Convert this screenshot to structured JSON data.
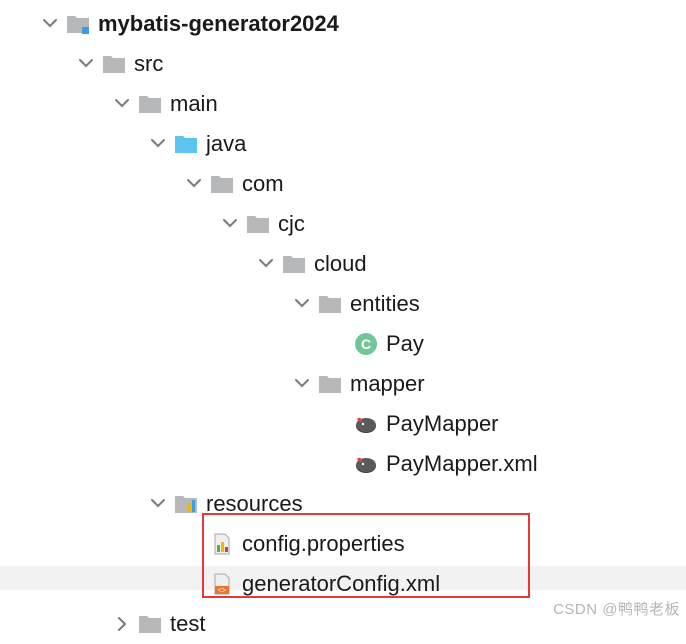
{
  "tree": {
    "root": {
      "label": "mybatis-generator2024"
    },
    "src": {
      "label": "src"
    },
    "main": {
      "label": "main"
    },
    "java": {
      "label": "java"
    },
    "com": {
      "label": "com"
    },
    "cjc": {
      "label": "cjc"
    },
    "cloud": {
      "label": "cloud"
    },
    "entities": {
      "label": "entities"
    },
    "pay": {
      "label": "Pay"
    },
    "mapper": {
      "label": "mapper"
    },
    "paymapper": {
      "label": "PayMapper"
    },
    "paymapperxml": {
      "label": "PayMapper.xml"
    },
    "resources": {
      "label": "resources"
    },
    "configprops": {
      "label": "config.properties"
    },
    "gencfg": {
      "label": "generatorConfig.xml"
    },
    "test": {
      "label": "test"
    }
  },
  "watermark": "CSDN @鸭鸭老板"
}
